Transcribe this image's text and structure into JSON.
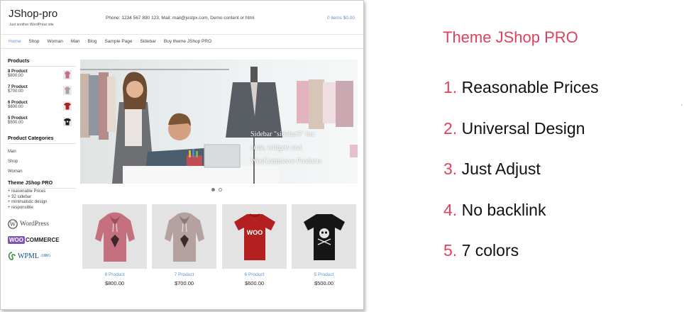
{
  "site": {
    "logo": "JShop-pro",
    "tagline": "Just another WordPress site",
    "contact": "Phone: 1234 567 890 123, Mail: mail@justpx.com, Demo content or html",
    "cart": "0 items $0.00",
    "nav": [
      "Home",
      "Shop",
      "Woman",
      "Man",
      "Blog",
      "Sample Page",
      "Sidebar",
      "Buy theme JShop PRO"
    ],
    "active_nav": "Home",
    "accent_color": "#5b93c9"
  },
  "sidebar": {
    "products_heading": "Products",
    "products": [
      {
        "name": "8 Product",
        "price": "$800.00",
        "icon": "pink-hoodie-icon"
      },
      {
        "name": "7 Product",
        "price": "$700.00",
        "icon": "grey-hoodie-icon"
      },
      {
        "name": "6 Product",
        "price": "$600.00",
        "icon": "red-tshirt-icon"
      },
      {
        "name": "5 Product",
        "price": "$500.00",
        "icon": "black-tshirt-icon"
      }
    ],
    "categories_heading": "Product Categories",
    "categories": [
      "Man",
      "Shop",
      "Woman"
    ],
    "theme_heading": "Theme JShop PRO",
    "theme_lines": [
      "+ reasonable Prices",
      "+ 32 sidebar",
      "+ minimalistic design",
      "+ responsible"
    ],
    "logos": {
      "wordpress": "WordPress",
      "woo": "WOO",
      "commerce": "COMMERCE",
      "wpml": "WPML",
      "wpml_org": ".ORG"
    }
  },
  "hero": {
    "lines": [
      "Sidebar \"sidebar5\" for:",
      "code, widgets and",
      "WooCommerce Products"
    ],
    "dots": 2,
    "active_dot": 1
  },
  "products": [
    {
      "name": "8 Product",
      "price": "$800.00",
      "icon": "pink-hoodie-icon"
    },
    {
      "name": "7 Product",
      "price": "$700.00",
      "icon": "grey-hoodie-icon"
    },
    {
      "name": "6 Product",
      "price": "$600.00",
      "icon": "red-woo-tshirt-icon",
      "print": "WOO"
    },
    {
      "name": "5 Product",
      "price": "$500.00",
      "icon": "black-skull-tshirt-icon"
    }
  ],
  "slide": {
    "title": "Theme JShop PRO",
    "accent_color": "#e0415e",
    "features": [
      {
        "num": "1.",
        "text": "Reasonable Prices"
      },
      {
        "num": "2.",
        "text": "Universal Design"
      },
      {
        "num": "3.",
        "text": "Just Adjust"
      },
      {
        "num": "4.",
        "text": "No backlink"
      },
      {
        "num": "5.",
        "text": "7 colors"
      }
    ]
  }
}
